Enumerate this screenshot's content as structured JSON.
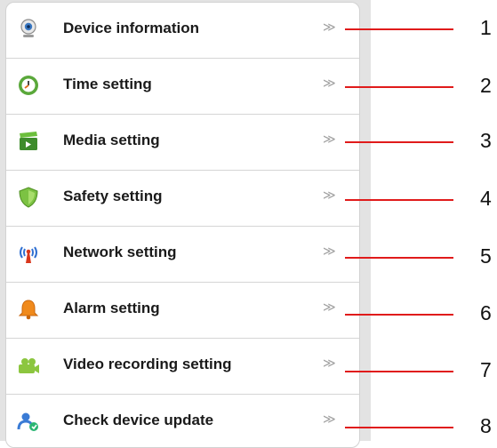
{
  "menu": {
    "chevron": "≫",
    "items": [
      {
        "label": "Device information",
        "icon": "webcam-icon",
        "callout": "1"
      },
      {
        "label": "Time setting",
        "icon": "clock-icon",
        "callout": "2"
      },
      {
        "label": "Media setting",
        "icon": "clapperboard-icon",
        "callout": "3"
      },
      {
        "label": "Safety setting",
        "icon": "shield-icon",
        "callout": "4"
      },
      {
        "label": "Network setting",
        "icon": "antenna-icon",
        "callout": "5"
      },
      {
        "label": "Alarm setting",
        "icon": "bell-icon",
        "callout": "6"
      },
      {
        "label": "Video recording setting",
        "icon": "video-camera-icon",
        "callout": "7"
      },
      {
        "label": "Check device update",
        "icon": "users-update-icon",
        "callout": "8"
      }
    ]
  },
  "colors": {
    "callout_line": "#e01b1b",
    "background_strip": "#e3e3e3",
    "chevron": "#a0a0a0"
  }
}
